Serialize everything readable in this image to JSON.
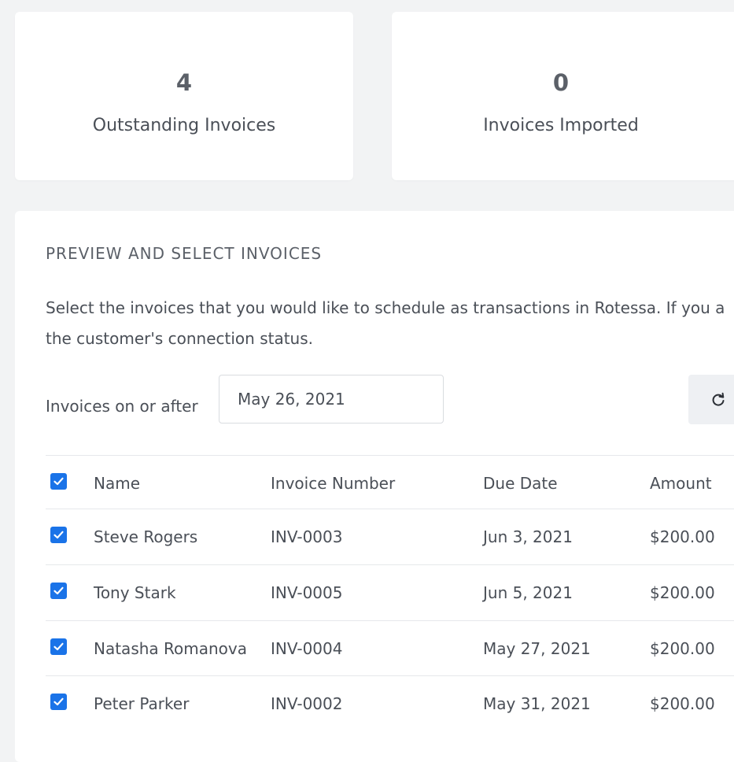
{
  "stats": [
    {
      "value": "4",
      "label": "Outstanding Invoices"
    },
    {
      "value": "0",
      "label": "Invoices Imported"
    }
  ],
  "section": {
    "title": "PREVIEW AND SELECT INVOICES",
    "description_line1": "Select the invoices that you would like to schedule as transactions in Rotessa. If you a",
    "description_line2": "the customer's connection status."
  },
  "filter": {
    "label": "Invoices on or after",
    "date_value": "May 26, 2021",
    "refresh_icon": "refresh-icon"
  },
  "table": {
    "headers": {
      "name": "Name",
      "invoice_number": "Invoice Number",
      "due_date": "Due Date",
      "amount": "Amount"
    },
    "rows": [
      {
        "name": "Steve Rogers",
        "invoice_number": "INV-0003",
        "due_date": "Jun 3, 2021",
        "amount": "$200.00",
        "checked": true
      },
      {
        "name": "Tony Stark",
        "invoice_number": "INV-0005",
        "due_date": "Jun 5, 2021",
        "amount": "$200.00",
        "checked": true
      },
      {
        "name": "Natasha Romanova",
        "invoice_number": "INV-0004",
        "due_date": "May 27, 2021",
        "amount": "$200.00",
        "checked": true
      },
      {
        "name": "Peter Parker",
        "invoice_number": "INV-0002",
        "due_date": "May 31, 2021",
        "amount": "$200.00",
        "checked": true
      }
    ]
  },
  "colors": {
    "accent": "#1a73e8",
    "background": "#f2f3f4",
    "card": "#ffffff",
    "text": "#4a4f57"
  }
}
